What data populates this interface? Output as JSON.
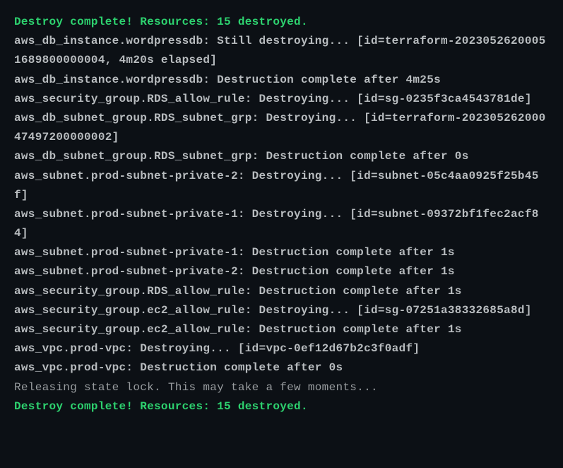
{
  "lines": {
    "l0": "Destroy complete! Resources: 15 destroyed.",
    "l1": "aws_db_instance.wordpressdb: Still destroying... [id=terraform-20230526200051689800000004, 4m20s elapsed]",
    "l2": "aws_db_instance.wordpressdb: Destruction complete after 4m25s",
    "l3": "aws_security_group.RDS_allow_rule: Destroying... [id=sg-0235f3ca4543781de]",
    "l4": "aws_db_subnet_group.RDS_subnet_grp: Destroying... [id=terraform-20230526200047497200000002]",
    "l5": "aws_db_subnet_group.RDS_subnet_grp: Destruction complete after 0s",
    "l6": "aws_subnet.prod-subnet-private-2: Destroying... [id=subnet-05c4aa0925f25b45f]",
    "l7": "aws_subnet.prod-subnet-private-1: Destroying... [id=subnet-09372bf1fec2acf84]",
    "l8": "aws_subnet.prod-subnet-private-1: Destruction complete after 1s",
    "l9": "aws_subnet.prod-subnet-private-2: Destruction complete after 1s",
    "l10": "aws_security_group.RDS_allow_rule: Destruction complete after 1s",
    "l11": "aws_security_group.ec2_allow_rule: Destroying... [id=sg-07251a38332685a8d]",
    "l12": "aws_security_group.ec2_allow_rule: Destruction complete after 1s",
    "l13": "aws_vpc.prod-vpc: Destroying... [id=vpc-0ef12d67b2c3f0adf]",
    "l14": "aws_vpc.prod-vpc: Destruction complete after 0s",
    "l15": "Releasing state lock. This may take a few moments...",
    "l16": "",
    "l17": "Destroy complete! Resources: 15 destroyed."
  }
}
